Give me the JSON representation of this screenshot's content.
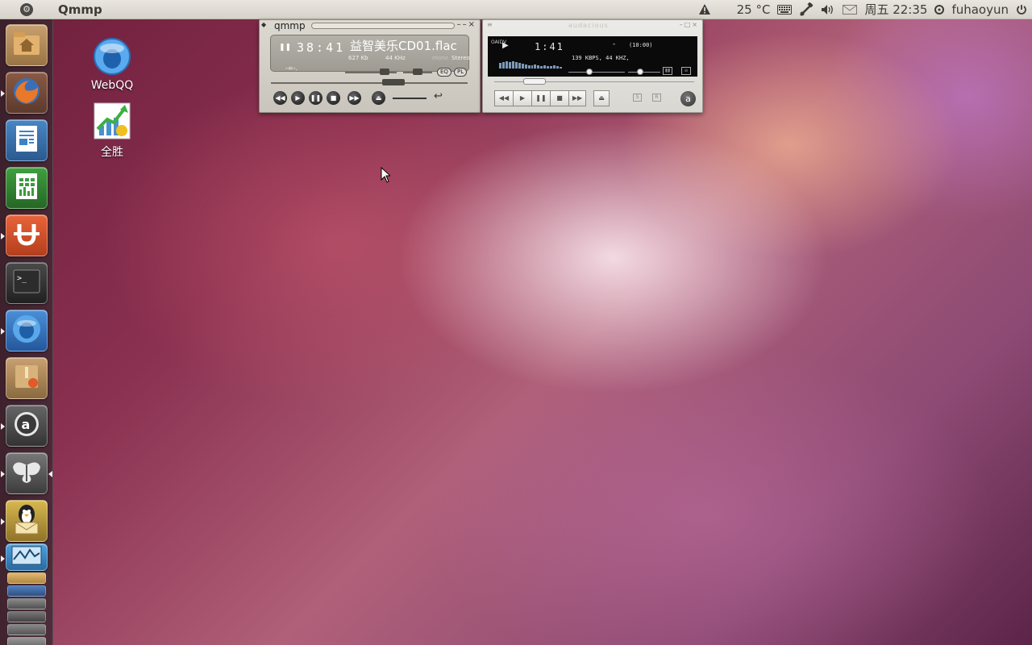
{
  "top_panel": {
    "app_title": "Qmmp",
    "weather": "25 °C",
    "clock": "周五 22:35",
    "user": "fuhaoyun",
    "icons": [
      "bfb-ubuntu-icon",
      "warning-icon",
      "moon-weather-icon",
      "keyboard-icon",
      "network-icon",
      "volume-icon",
      "mail-icon",
      "user-icon",
      "power-icon"
    ]
  },
  "launcher": {
    "items": [
      {
        "name": "home-folder",
        "icon": "folder-home-icon",
        "color": "#d8a25a",
        "bg": "#b7884b"
      },
      {
        "name": "firefox",
        "icon": "firefox-icon",
        "color": "#e47a2a",
        "bg": "#9a5a3a"
      },
      {
        "name": "libreoffice-writer",
        "icon": "writer-icon",
        "color": "#3c82c4",
        "bg": "#2f5d8f"
      },
      {
        "name": "libreoffice-calc",
        "icon": "calc-icon",
        "color": "#3c9b3c",
        "bg": "#2b6d2f"
      },
      {
        "name": "ubuntu-one",
        "icon": "ubuntu-one-icon",
        "color": "#e05a2a",
        "bg": "#b44326"
      },
      {
        "name": "terminal",
        "icon": "terminal-icon",
        "color": "#2b2b2b",
        "bg": "#3a3a3a"
      },
      {
        "name": "webqq",
        "icon": "webqq-icon",
        "color": "#3b8de0",
        "bg": "#2a5f9e"
      },
      {
        "name": "software-center",
        "icon": "package-icon",
        "color": "#c89a5a",
        "bg": "#9a7640"
      },
      {
        "name": "amarok",
        "icon": "amarok-icon",
        "color": "#5a5a5a",
        "bg": "#4a4a4a"
      },
      {
        "name": "mothbird",
        "icon": "moth-icon",
        "color": "#6a6a6a",
        "bg": "#555555"
      },
      {
        "name": "qq-mail",
        "icon": "penguin-mail-icon",
        "color": "#d9b446",
        "bg": "#9a7d2e"
      },
      {
        "name": "system-monitor",
        "icon": "monitor-icon",
        "color": "#3a8fd0",
        "bg": "#2d6a99"
      }
    ]
  },
  "desktop_icons": [
    {
      "label": "WebQQ",
      "icon": "webqq-icon"
    },
    {
      "label": "全胜",
      "icon": "chart-arrow-icon"
    }
  ],
  "qmmp": {
    "title": "qmmp",
    "time": "38:41",
    "song": "益智美乐CD01.flac",
    "bitrate": "627 Kb",
    "samplerate": "44 KHz",
    "mono": "mono",
    "stereo": "Stereo",
    "eq_label": "EQ",
    "pl_label": "PL"
  },
  "audacious": {
    "title": "audacious",
    "time": "1:41",
    "dash": "-",
    "duration": "(10:00)",
    "info": "139 KBPS, 44 KHZ,",
    "side_letters": "OAIDV",
    "shuffle": "S",
    "repeat": "R"
  }
}
